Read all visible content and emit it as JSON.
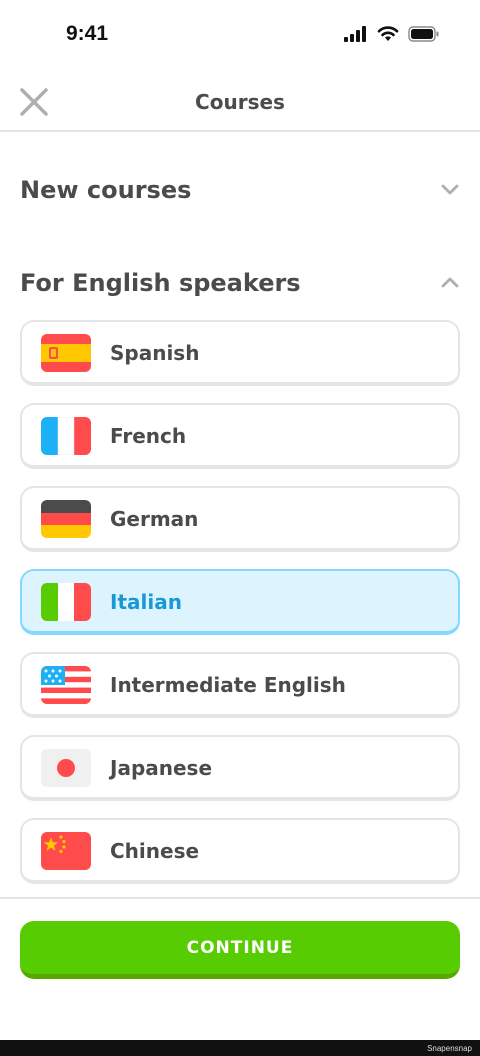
{
  "status_bar": {
    "time": "9:41",
    "icons": [
      "signal-icon",
      "wifi-icon",
      "battery-icon"
    ]
  },
  "header": {
    "title": "Courses",
    "close_icon": "close-icon"
  },
  "sections": {
    "new_courses": {
      "title": "New courses",
      "expanded": false
    },
    "english_speakers": {
      "title": "For English speakers",
      "expanded": true
    }
  },
  "courses": [
    {
      "label": "Spanish",
      "flag": "spain-flag-icon",
      "selected": false
    },
    {
      "label": "French",
      "flag": "france-flag-icon",
      "selected": false
    },
    {
      "label": "German",
      "flag": "germany-flag-icon",
      "selected": false
    },
    {
      "label": "Italian",
      "flag": "italy-flag-icon",
      "selected": true
    },
    {
      "label": "Intermediate English",
      "flag": "usa-flag-icon",
      "selected": false
    },
    {
      "label": "Japanese",
      "flag": "japan-flag-icon",
      "selected": false
    },
    {
      "label": "Chinese",
      "flag": "china-flag-icon",
      "selected": false
    }
  ],
  "footer": {
    "continue_label": "CONTINUE"
  },
  "watermark": "Snapensnap",
  "colors": {
    "primary_green": "#58cc02",
    "selected_bg": "#ddf4ff",
    "selected_border": "#84d8ff",
    "selected_text": "#1899d6",
    "text": "#4b4b4b",
    "border": "#e5e5e5"
  }
}
